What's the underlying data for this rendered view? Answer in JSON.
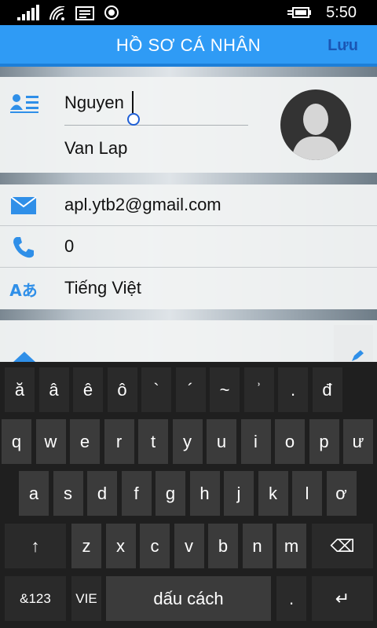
{
  "status_bar": {
    "time": "5:50"
  },
  "header": {
    "title": "HỒ SƠ CÁ NHÂN",
    "save_label": "Lưu"
  },
  "profile": {
    "first_name": "Nguyen",
    "last_name": "Van Lap",
    "email": "apl.ytb2@gmail.com",
    "phone": "0",
    "language": "Tiếng Việt"
  },
  "icons": {
    "contact": "contact-card-icon",
    "email": "envelope-icon",
    "phone": "phone-icon",
    "language": "language-icon",
    "avatar": "avatar-silhouette-icon",
    "edit": "pencil-icon",
    "home": "home-icon"
  },
  "colors": {
    "accent": "#2f9bf5",
    "save": "#1a56b4",
    "icon": "#2f8fe8"
  },
  "keyboard": {
    "row1": [
      "ă",
      "â",
      "ê",
      "ô",
      "`",
      "´",
      "~",
      "ʾ",
      ".",
      "đ"
    ],
    "row2": [
      "q",
      "w",
      "e",
      "r",
      "t",
      "y",
      "u",
      "i",
      "o",
      "p",
      "ư"
    ],
    "row3": [
      "a",
      "s",
      "d",
      "f",
      "g",
      "h",
      "j",
      "k",
      "l",
      "ơ"
    ],
    "row4": [
      "z",
      "x",
      "c",
      "v",
      "b",
      "n",
      "m"
    ],
    "shift": "↑",
    "backspace": "⌫",
    "numbers": "&123",
    "lang": "VIE",
    "space": "dấu cách",
    "dot": ".",
    "enter": "↵"
  }
}
